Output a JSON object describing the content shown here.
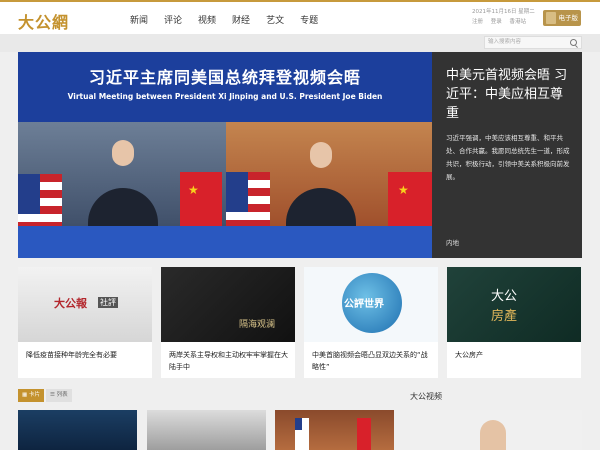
{
  "header": {
    "logo": "大公網",
    "nav": [
      "新闻",
      "评论",
      "视频",
      "财经",
      "艺文",
      "专题"
    ],
    "date": "2021年11月16日 星期二",
    "links": [
      "注册",
      "登录",
      "香港站"
    ],
    "epaper": "电子版"
  },
  "search": {
    "placeholder": "输入搜索内容"
  },
  "hero": {
    "title_cn": "习近平主席同美国总统拜登视频会晤",
    "title_en": "Virtual Meeting between President Xi Jinping and U.S. President Joe Biden"
  },
  "side": {
    "title": "中美元首视频会晤 习近平：中美应相互尊重",
    "summary": "习近平强调，中美应该相互尊重、和平共处、合作共赢。我愿同总统先生一道，形成共识，积极行动，引领中美关系积极向前发展。",
    "tag": "内地"
  },
  "cards": [
    {
      "caption": "降低疫苗接种年龄完全有必要",
      "logo": "大公報",
      "logo2": "社評"
    },
    {
      "caption": "两岸关系主导权和主动权牢牢掌握在大陆手中",
      "logo": "隔海观澜"
    },
    {
      "caption": "中美首脑视频会晤凸显双边关系的“战略性”",
      "logo": "公評世界"
    },
    {
      "caption": "大公房产",
      "logo": "大公",
      "logo2": "房產"
    }
  ],
  "tabs": [
    "卡片",
    "列表"
  ],
  "video_section": "大公视频"
}
